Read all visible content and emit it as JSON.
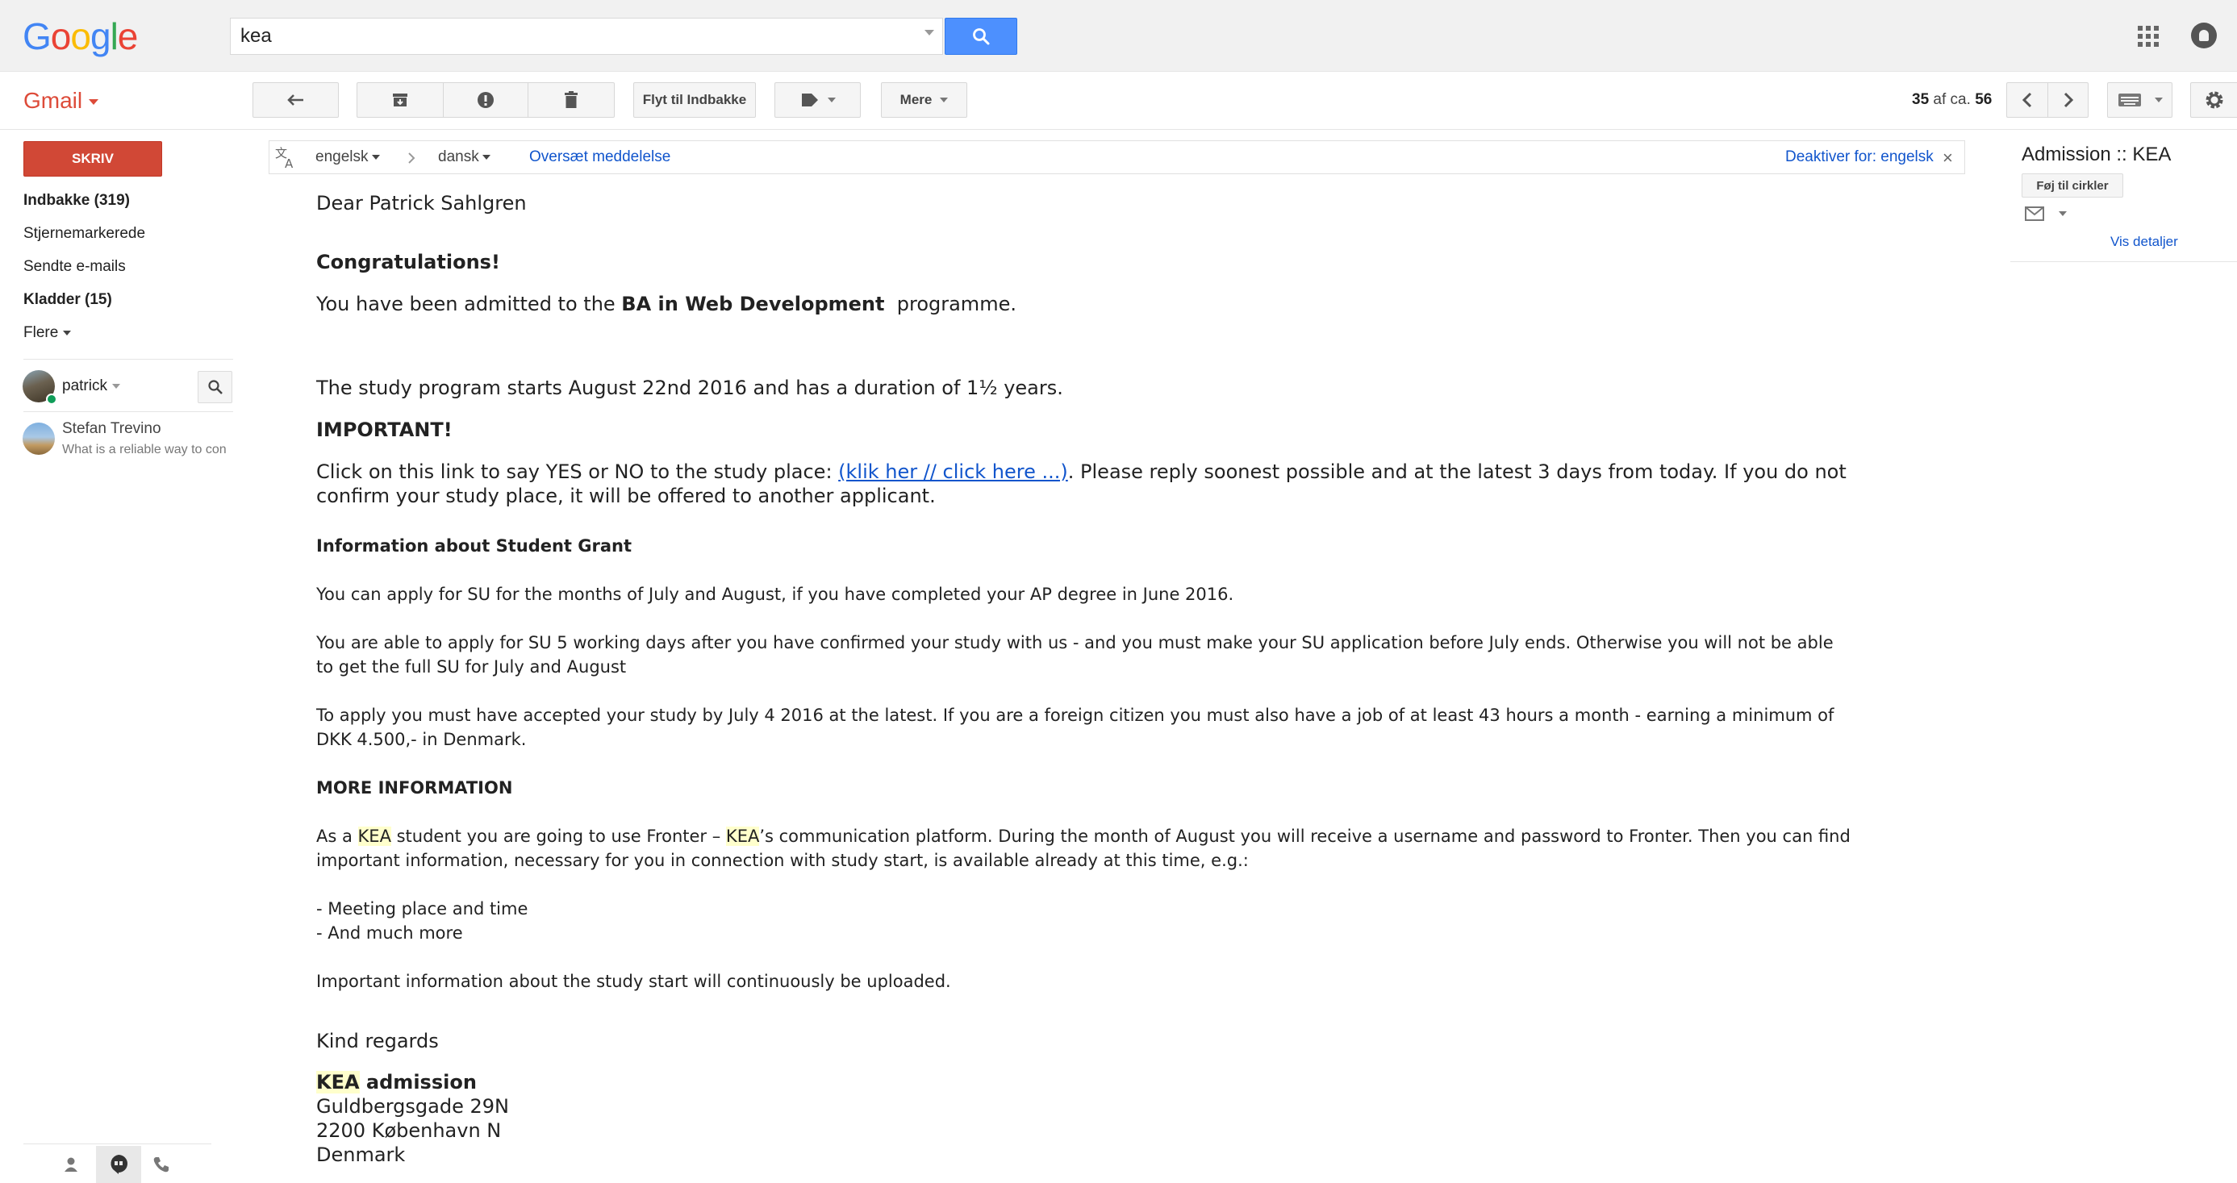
{
  "header": {
    "logo": "Google",
    "search_value": "kea"
  },
  "toolbar": {
    "app_label": "Gmail",
    "move_to_inbox": "Flyt til Indbakke",
    "more": "Mere",
    "count_current": "35",
    "count_of": "af ca.",
    "count_total": "56"
  },
  "nav": {
    "compose": "SKRIV",
    "items": [
      {
        "label": "Indbakke (319)"
      },
      {
        "label": "Stjernemarkerede"
      },
      {
        "label": "Sendte e-mails"
      },
      {
        "label": "Kladder (15)"
      },
      {
        "label": "Flere"
      }
    ],
    "hangouts_user": "patrick",
    "contact_name": "Stefan Trevino",
    "contact_snippet": "What is a reliable way to con"
  },
  "translate": {
    "from_lang": "engelsk",
    "to_lang": "dansk",
    "translate_link": "Oversæt meddelelse",
    "disable_link": "Deaktiver for: engelsk"
  },
  "message": {
    "greeting": "Dear Patrick Sahlgren",
    "congrats": "Congratulations!",
    "admitted_pre": "You have been admitted to the ",
    "admitted_program": "BA in Web Development",
    "admitted_post": "  programme.",
    "start": "The study program starts August 22nd 2016 and has a duration of 1½ years.",
    "important": "IMPORTANT!",
    "click_pre": "Click on this link to say YES or NO to the study place: ",
    "click_link": "(klik her // click here ...)",
    "click_post": ". Please reply soonest possible and at the latest 3 days from today. If you do not",
    "click_line2": "confirm your study place, it will be offered to another applicant.",
    "grant_heading": "Information about Student Grant",
    "grant_p1": "You can apply for SU for the months of July and August, if you have completed your AP degree in June 2016.",
    "grant_p2_l1": "You are able to apply for SU 5 working days after you have confirmed your study with us - and you must make your SU application before July ends. Otherwise you will not be able",
    "grant_p2_l2": "to get the full SU for July and August",
    "grant_p3_l1": "To apply you must have accepted your study by July 4 2016 at the latest. If you are a foreign citizen you must also have a job of at least 43 hours a month - earning a minimum of",
    "grant_p3_l2": "DKK 4.500,- in Denmark.",
    "more_heading": "MORE INFORMATION",
    "more_p1_a": "As a ",
    "more_p1_kea1": "KEA",
    "more_p1_b": " student you are going to use Fronter – ",
    "more_p1_kea2": "KEA",
    "more_p1_c": "’s communication platform. During the month of August you will receive a username and password to Fronter. Then you can find",
    "more_p1_l2": "important information, necessary for you in connection with study start, is available already at this time, e.g.:",
    "bullet1": "- Meeting place and time",
    "bullet2": "- And much more",
    "upload_note": "Important information about the study start will continuously be uploaded.",
    "regards": "Kind regards",
    "sig_kea": "KEA",
    "sig_admission": " admission",
    "addr1": "Guldbergsgade 29N",
    "addr2": "2200 København N",
    "addr3": "Denmark"
  },
  "sidebar_right": {
    "sender": "Admission :: KEA",
    "add_circles": "Føj til cirkler",
    "details": "Vis detaljer"
  },
  "colors": {
    "compose_red": "#d14836",
    "search_blue": "#4d90fe",
    "link_blue": "#1155cc",
    "highlight": "#ffffcc"
  }
}
